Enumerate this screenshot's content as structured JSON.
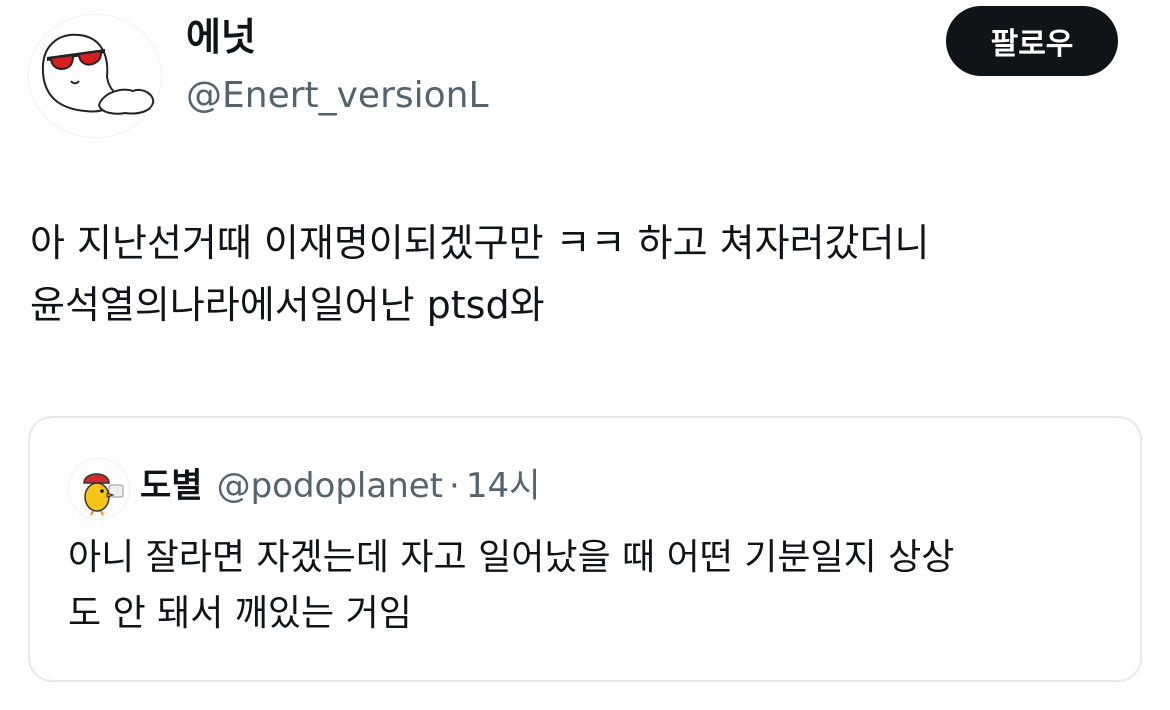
{
  "author": {
    "display_name": "에넛",
    "handle": "@Enert_versionL",
    "avatar_icon": "ghost-sunglasses-avatar"
  },
  "follow_button": {
    "label": "팔로우"
  },
  "tweet": {
    "lines": [
      "아 지난선거때 이재명이되겠구만 ㅋㅋ 하고 쳐자러갔더니",
      "윤석열의나라에서일어난 ptsd와"
    ]
  },
  "quoted_tweet": {
    "display_name": "도별",
    "handle": "@podoplanet",
    "separator": "·",
    "time": "14시",
    "avatar_icon": "duck-avatar",
    "lines": [
      "아니 잘라면 자겠는데 자고 일어났을 때 어떤 기분일지 상상",
      "도 안 돼서 깨있는 거임"
    ]
  },
  "colors": {
    "text_primary": "#0f1419",
    "text_secondary": "#536471",
    "button_bg": "#0f1419",
    "card_border": "#e6e9ec"
  }
}
